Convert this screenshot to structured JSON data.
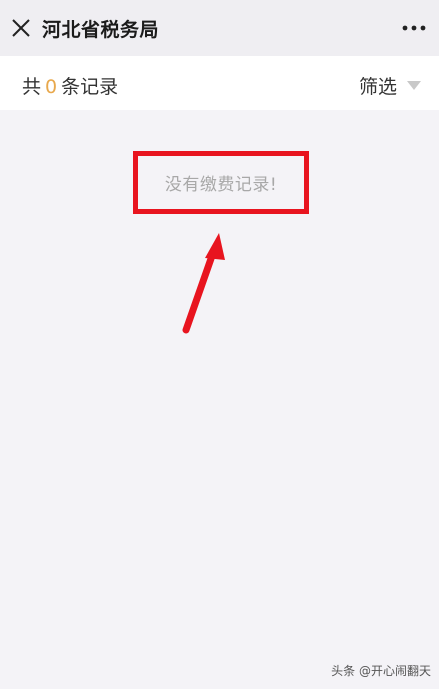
{
  "header": {
    "title": "河北省税务局",
    "close_icon": "close-icon",
    "more_icon": "more-horizontal-icon"
  },
  "filter_bar": {
    "prefix": "共",
    "count": "0",
    "suffix": "条记录",
    "filter_label": "筛选",
    "filter_icon": "caret-down-icon"
  },
  "empty_state": {
    "message": "没有缴费记录!"
  },
  "annotation": {
    "color": "#e8141f"
  },
  "watermark": {
    "text": "头条 @开心闹翻天"
  },
  "colors": {
    "count_accent": "#e8a84c",
    "page_background": "#f4f3f7"
  }
}
